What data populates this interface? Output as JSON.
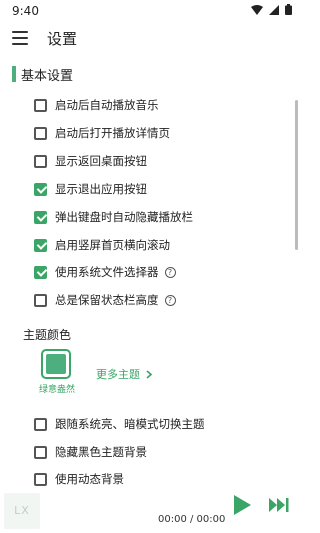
{
  "status_bar": {
    "time": "9:40"
  },
  "app_bar": {
    "title": "设置"
  },
  "section": {
    "title": "基本设置"
  },
  "options": [
    {
      "label": "启动后自动播放音乐",
      "checked": false,
      "help": false
    },
    {
      "label": "启动后打开播放详情页",
      "checked": false,
      "help": false
    },
    {
      "label": "显示返回桌面按钮",
      "checked": false,
      "help": false
    },
    {
      "label": "显示退出应用按钮",
      "checked": true,
      "help": false
    },
    {
      "label": "弹出键盘时自动隐藏播放栏",
      "checked": true,
      "help": false
    },
    {
      "label": "启用竖屏首页横向滚动",
      "checked": true,
      "help": false
    },
    {
      "label": "使用系统文件选择器",
      "checked": true,
      "help": true
    },
    {
      "label": "总是保留状态栏高度",
      "checked": false,
      "help": true
    }
  ],
  "theme": {
    "heading": "主题颜色",
    "selected_name": "绿意盎然",
    "selected_color": "#4caf7d",
    "more_label": "更多主题"
  },
  "theme_options": [
    {
      "label": "跟随系统亮、暗模式切换主题",
      "checked": false
    },
    {
      "label": "隐藏黑色主题背景",
      "checked": false
    },
    {
      "label": "使用动态背景",
      "checked": false
    }
  ],
  "player": {
    "thumb_text": "LX",
    "time": "00:00 / 00:00"
  },
  "colors": {
    "accent": "#3aa566"
  }
}
